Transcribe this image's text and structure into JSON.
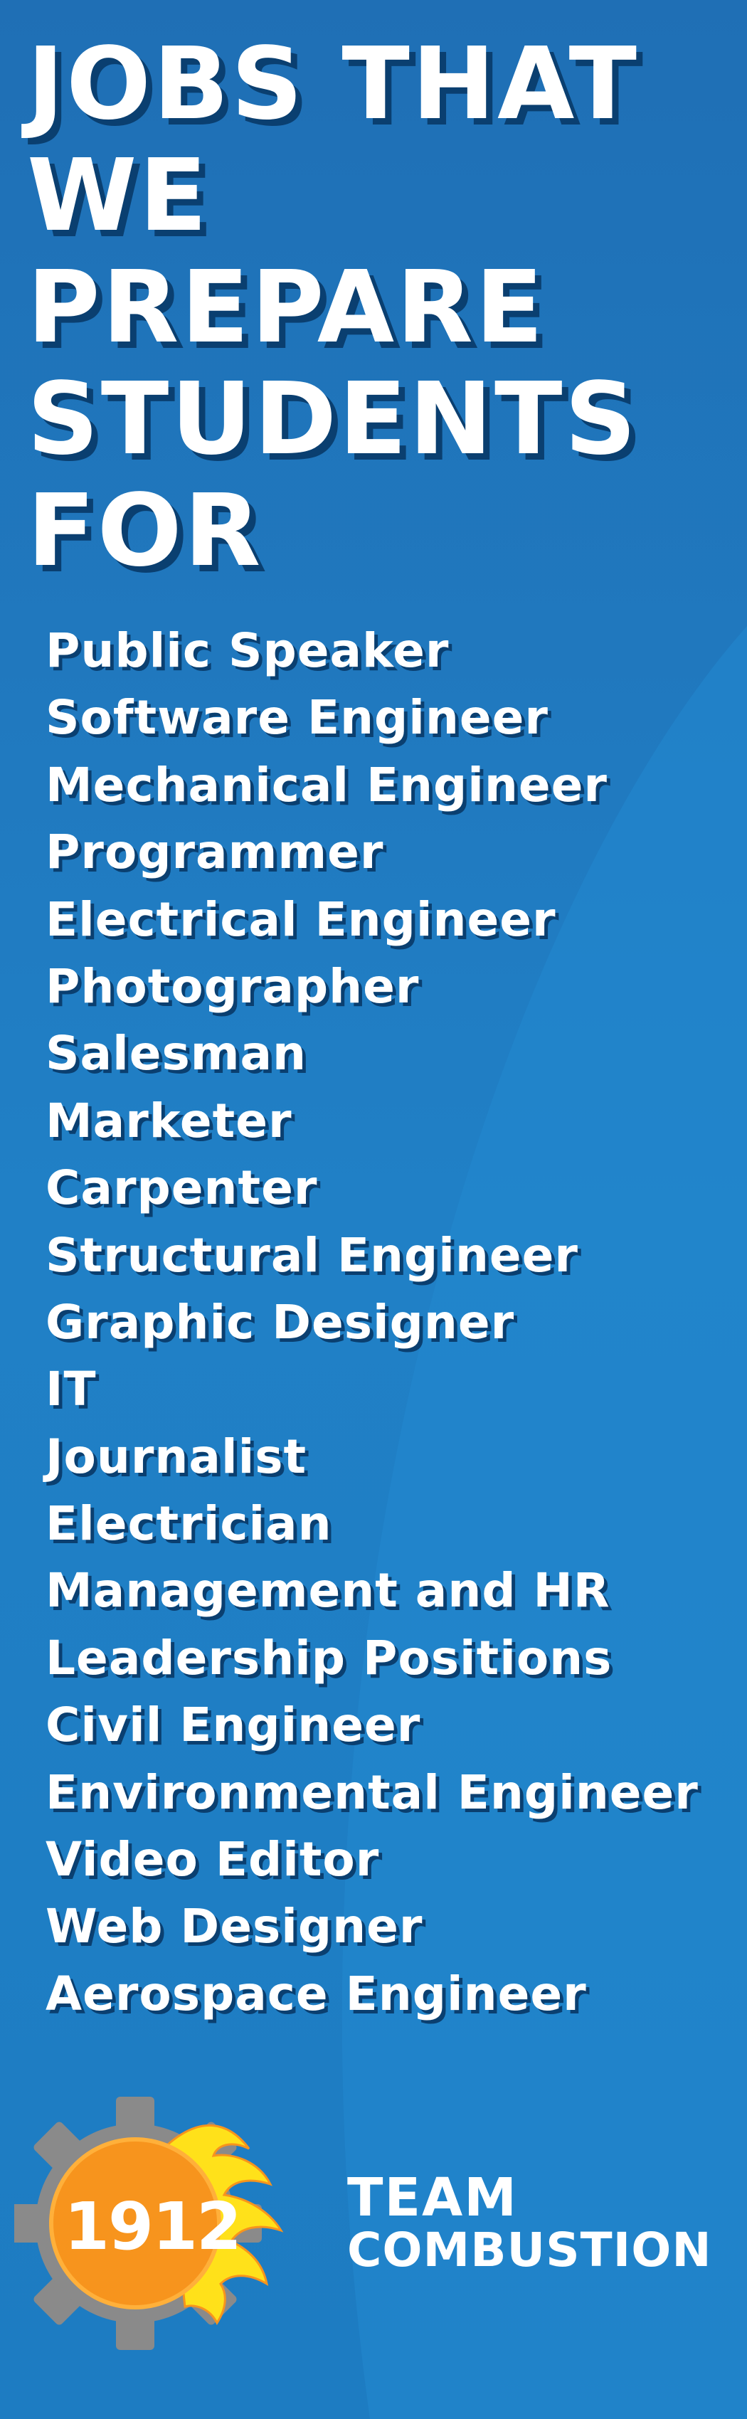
{
  "poster": {
    "title_lines": [
      "JOBS THAT",
      "WE",
      "PREPARE",
      "STUDENTS",
      "FOR"
    ],
    "jobs": [
      "Public Speaker",
      "Software Engineer",
      "Mechanical Engineer",
      "Programmer",
      "Electrical Engineer",
      "Photographer",
      "Salesman",
      "Marketer",
      "Carpenter",
      "Structural Engineer",
      "Graphic Designer",
      "IT",
      "Journalist",
      "Electrician",
      "Management and HR",
      "Leadership Positions",
      "Civil Engineer",
      "Environmental Engineer",
      "Video Editor",
      "Web Designer",
      "Aerospace Engineer"
    ]
  },
  "logo": {
    "number": "1912",
    "team_line1": "TEAM",
    "team_line2": "COMBUSTION",
    "icon": "gear-flame-icon"
  },
  "colors": {
    "background": "#1f76bd",
    "text": "#ffffff",
    "text_shadow": "#0a3f70",
    "gear": "#8a8a8a",
    "sun": "#f7941d",
    "flame": "#ffe11a"
  }
}
